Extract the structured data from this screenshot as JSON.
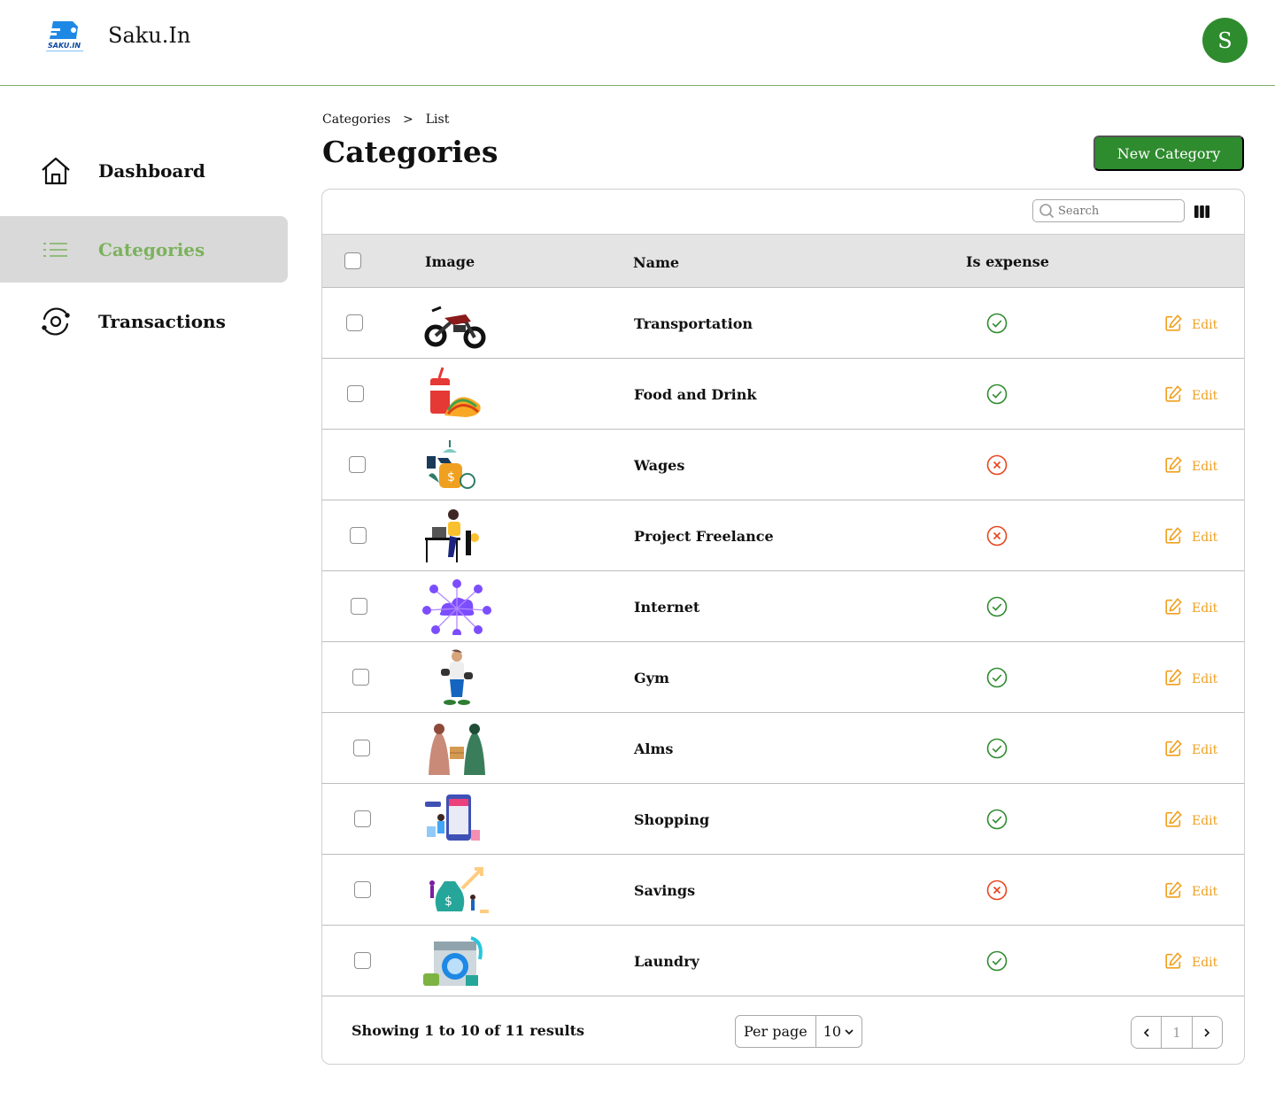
{
  "app": {
    "brand": "Saku.In",
    "logo_text": "SAKU.IN",
    "avatar_initial": "S"
  },
  "colors": {
    "primary": "#2e8b2e",
    "accent_active": "#7bb25c",
    "edit": "#f0a020",
    "check": "#2e8b2e",
    "cross": "#e8451f",
    "active_bg": "#d9d9d9"
  },
  "sidebar": {
    "items": [
      {
        "label": "Dashboard",
        "icon": "home-icon",
        "active": false
      },
      {
        "label": "Categories",
        "icon": "list-icon",
        "active": true
      },
      {
        "label": "Transactions",
        "icon": "refresh-icon",
        "active": false
      }
    ]
  },
  "breadcrumb": {
    "parent": "Categories",
    "separator": ">",
    "current": "List"
  },
  "page": {
    "title": "Categories",
    "new_button": "New Category"
  },
  "table": {
    "search_placeholder": "Search",
    "columns_icon": "columns-icon",
    "headers": {
      "image": "Image",
      "name": "Name",
      "is_expense": "Is expense"
    },
    "edit_label": "Edit",
    "rows": [
      {
        "name": "Transportation",
        "image": "motorbike-illustration",
        "is_expense": true
      },
      {
        "name": "Food and Drink",
        "image": "soda-taco-illustration",
        "is_expense": true
      },
      {
        "name": "Wages",
        "image": "money-bag-clock-illustration",
        "is_expense": false
      },
      {
        "name": "Project Freelance",
        "image": "person-at-desk-illustration",
        "is_expense": false
      },
      {
        "name": "Internet",
        "image": "cloud-network-illustration",
        "is_expense": true
      },
      {
        "name": "Gym",
        "image": "man-dumbbells-illustration",
        "is_expense": true
      },
      {
        "name": "Alms",
        "image": "women-giving-box-illustration",
        "is_expense": true
      },
      {
        "name": "Shopping",
        "image": "online-store-illustration",
        "is_expense": true
      },
      {
        "name": "Savings",
        "image": "money-sack-growth-illustration",
        "is_expense": false
      },
      {
        "name": "Laundry",
        "image": "washing-machine-illustration",
        "is_expense": true
      }
    ]
  },
  "footer": {
    "summary": "Showing 1 to 10 of 11 results",
    "per_page_label": "Per page",
    "per_page_value": "10",
    "current_page": "1"
  }
}
